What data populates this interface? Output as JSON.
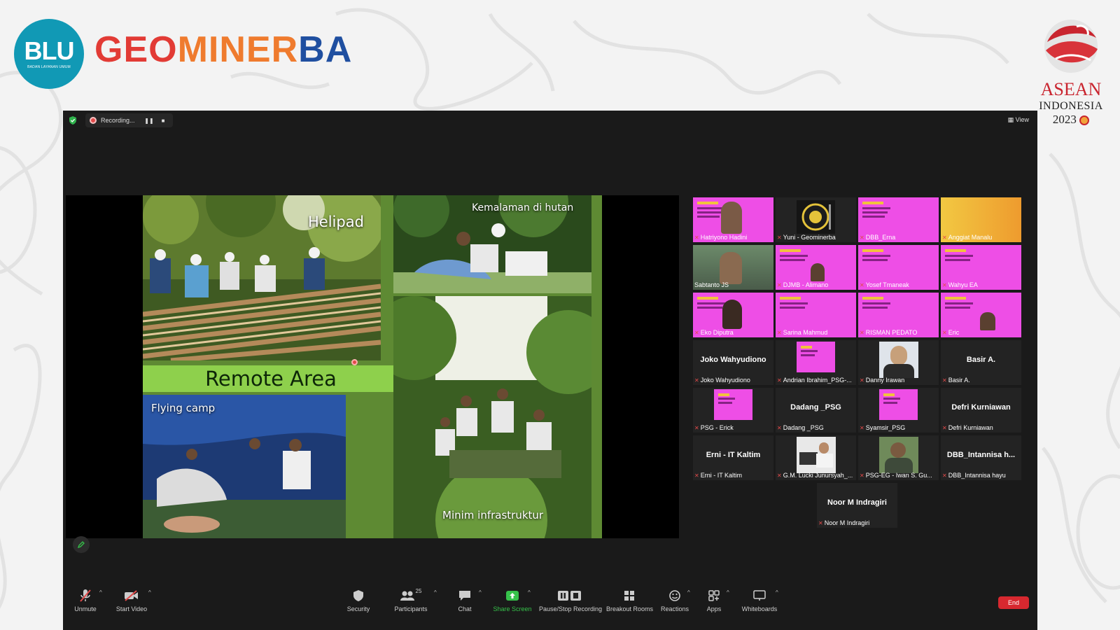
{
  "branding": {
    "blu_big": "BLU",
    "blu_small": "BADAN LAYANAN UMUM",
    "brand_part1": "GEO",
    "brand_part2": "MINER",
    "brand_part3": "BA",
    "asean_line1": "ASEAN",
    "asean_line2": "INDONESIA",
    "asean_line3": "2023"
  },
  "meeting": {
    "recording_label": "Recording...",
    "view_label": "View"
  },
  "slide": {
    "caption_helipad": "Helipad",
    "caption_kemalaman": "Kemalaman di hutan",
    "band_title": "Remote Area",
    "caption_flying_camp": "Flying camp",
    "caption_minim": "Minim infrastruktur"
  },
  "gallery": {
    "tiles": [
      {
        "label": "Hatriyono Hadini",
        "big": ""
      },
      {
        "label": "Yuni - Geominerba",
        "big": ""
      },
      {
        "label": "DBB_Erna",
        "big": ""
      },
      {
        "label": "Anggiat Manalu",
        "big": ""
      },
      {
        "label": "Sabtanto JS",
        "big": ""
      },
      {
        "label": "DJMB - Alimano",
        "big": ""
      },
      {
        "label": "Yosef Tmaneak",
        "big": ""
      },
      {
        "label": "Wahyu EA",
        "big": ""
      },
      {
        "label": "Eko Diputra",
        "big": ""
      },
      {
        "label": "Sarina Mahmud",
        "big": ""
      },
      {
        "label": "RISMAN PEDATO",
        "big": ""
      },
      {
        "label": "Eric",
        "big": ""
      },
      {
        "label": "Joko Wahyudiono",
        "big": "Joko Wahyudiono"
      },
      {
        "label": "Andrian Ibrahim_PSG-...",
        "big": ""
      },
      {
        "label": "Danny Irawan",
        "big": ""
      },
      {
        "label": "Basir A.",
        "big": "Basir A."
      },
      {
        "label": "PSG - Erick",
        "big": ""
      },
      {
        "label": "Dadang _PSG",
        "big": "Dadang _PSG"
      },
      {
        "label": "Syamsir_PSG",
        "big": ""
      },
      {
        "label": "Defri Kurniawan",
        "big": "Defri Kurniawan"
      },
      {
        "label": "Erni - IT Kaltim",
        "big": "Erni - IT Kaltim"
      },
      {
        "label": "G.M. Lucki Junursyah_...",
        "big": ""
      },
      {
        "label": "PSG-EG - Iwan S. Gu...",
        "big": ""
      },
      {
        "label": "DBB_Intannisa hayu",
        "big": "DBB_Intannisa h..."
      },
      {
        "label": "Noor M Indragiri",
        "big": "Noor M Indragiri"
      }
    ]
  },
  "toolbar": {
    "unmute": "Unmute",
    "start_video": "Start Video",
    "security": "Security",
    "participants": "Participants",
    "participants_count": "25",
    "chat": "Chat",
    "share_screen": "Share Screen",
    "pause_stop_recording": "Pause/Stop Recording",
    "breakout_rooms": "Breakout Rooms",
    "reactions": "Reactions",
    "apps": "Apps",
    "whiteboards": "Whiteboards",
    "end": "End"
  },
  "colors": {
    "brand_red": "#e23b35",
    "brand_orange": "#ef7b2e",
    "brand_blue": "#1f4fa0",
    "blu_teal": "#1199b5",
    "zoom_bg": "#1a1a1a",
    "tile_pink": "#ee4ee6",
    "share_green": "#36c24a",
    "end_red": "#d7282f"
  }
}
